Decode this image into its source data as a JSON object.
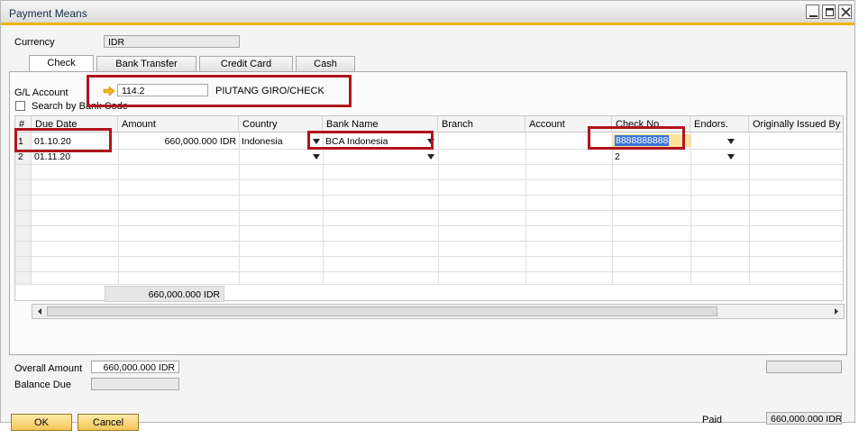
{
  "window": {
    "title": "Payment Means"
  },
  "currency": {
    "label": "Currency",
    "value": "IDR"
  },
  "tabs": [
    {
      "label": "Check",
      "active": true
    },
    {
      "label": "Bank Transfer",
      "active": false
    },
    {
      "label": "Credit Card",
      "active": false
    },
    {
      "label": "Cash",
      "active": false
    }
  ],
  "gl_account": {
    "label": "G/L Account",
    "value": "114.2",
    "name": "PIUTANG GIRO/CHECK"
  },
  "search_by_bank_code": {
    "label": "Search by Bank Code",
    "checked": false
  },
  "table": {
    "columns": [
      "#",
      "Due Date",
      "Amount",
      "Country",
      "Bank Name",
      "Branch",
      "Account",
      "Check No.",
      "Endors.",
      "Originally Issued By"
    ],
    "rows": [
      {
        "num": "1",
        "due_date": "01.10.20",
        "amount": "660,000.000 IDR",
        "country": "Indonesia",
        "bank_name": "BCA Indonesia",
        "branch": "",
        "account": "",
        "check_no": "8888888888",
        "endors": "",
        "issued_by": ""
      },
      {
        "num": "2",
        "due_date": "01.11.20",
        "amount": "",
        "country": "",
        "bank_name": "",
        "branch": "",
        "account": "",
        "check_no": "2",
        "endors": "",
        "issued_by": ""
      }
    ],
    "total_amount": "660,000.000 IDR"
  },
  "overall_amount": {
    "label": "Overall Amount",
    "value": "660,000.000 IDR"
  },
  "balance_due": {
    "label": "Balance Due",
    "value": ""
  },
  "paid": {
    "label": "Paid",
    "value": "660,000.000 IDR"
  },
  "buttons": {
    "ok": "OK",
    "cancel": "Cancel"
  },
  "colors": {
    "highlight_border": "#b0141d",
    "title_accent": "#f0b400",
    "button": "#f2c658",
    "selection": "#3a73d6"
  }
}
